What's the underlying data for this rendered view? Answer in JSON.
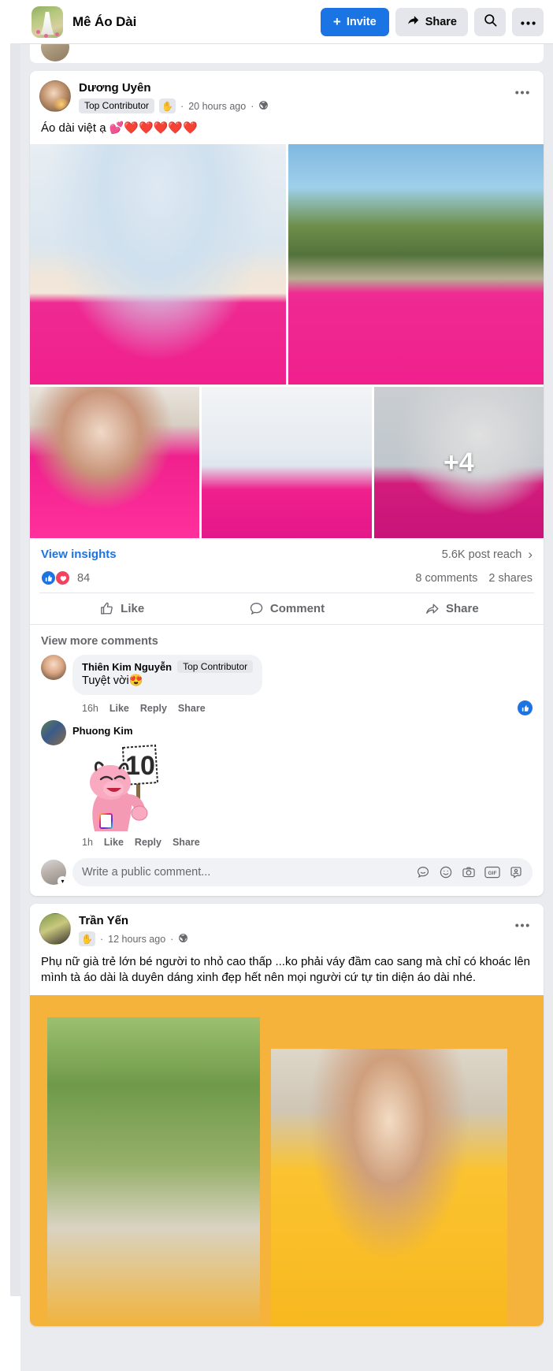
{
  "group": {
    "name": "Mê Áo Dài",
    "avatar_icon": "group-photo-avatar"
  },
  "topbar": {
    "invite_label": "Invite",
    "invite_plus": "+",
    "share_label": "Share",
    "search_icon": "search-icon",
    "more_icon": "ellipsis-icon",
    "accent_color": "#1b74e4"
  },
  "posts": [
    {
      "author": "Dương Uyên",
      "badge": "Top Contributor",
      "wave_icon": "waving-hand-icon",
      "separator": "·",
      "time": "20 hours ago",
      "privacy_icon": "globe-icon",
      "menu_icon": "ellipsis-icon",
      "text": "Áo dài việt ạ 💕❤️❤️❤️❤️❤️",
      "photos_more": "+4",
      "insights_label": "View insights",
      "reach": "5.6K post reach",
      "chevron": "›",
      "reaction_like_icon": "thumbs-up-reaction",
      "reaction_love_icon": "heart-reaction",
      "reaction_count": "84",
      "comments_count": "8 comments",
      "shares_count": "2 shares",
      "actions": [
        {
          "label": "Like",
          "icon": "thumbs-up-icon"
        },
        {
          "label": "Comment",
          "icon": "comment-bubble-icon"
        },
        {
          "label": "Share",
          "icon": "share-arrow-icon"
        }
      ],
      "view_more_comments": "View more comments",
      "comments": [
        {
          "name": "Thiên Kim Nguyễn",
          "badge": "Top Contributor",
          "text": "Tuyệt vời😍",
          "time": "16h",
          "like": "Like",
          "reply": "Reply",
          "share": "Share",
          "liked_icon": "thumbs-up-filled-icon"
        },
        {
          "name": "Phuong Kim",
          "sticker": "pink-panther-10-sticker",
          "sticker_number": "10",
          "time": "1h",
          "like": "Like",
          "reply": "Reply",
          "share": "Share"
        }
      ],
      "composer": {
        "placeholder": "Write a public comment...",
        "icons": [
          "sticker-icon",
          "emoji-icon",
          "camera-icon",
          "gif-icon",
          "avatar-sticker-icon"
        ]
      }
    },
    {
      "author": "Trần Yến",
      "wave_icon": "waving-hand-icon",
      "separator": "·",
      "time": "12 hours ago",
      "privacy_icon": "globe-icon",
      "menu_icon": "ellipsis-icon",
      "text": "Phụ nữ già trẻ lớn bé người to nhỏ cao thấp ...ko phải váy đầm cao sang mà chỉ có khoác lên mình tà áo dài là duyên dáng xinh đẹp hết nên mọi người cứ tự tin diện áo dài nhé."
    }
  ],
  "colors": {
    "fb_blue": "#1b74e4",
    "page_bg": "#e9ebee",
    "card_bg": "#ffffff",
    "muted_text": "#65676b",
    "primary_text": "#050505",
    "chip_bg": "#e4e6eb",
    "pink_aodai": "#f0208d",
    "yellow_bg": "#f6b33b"
  }
}
